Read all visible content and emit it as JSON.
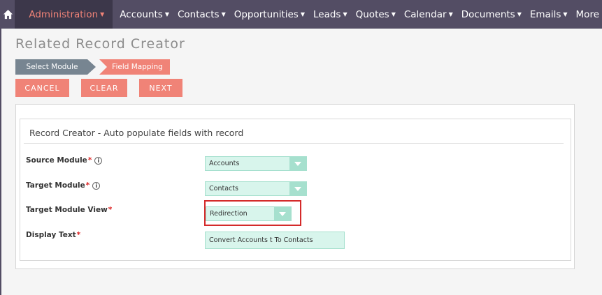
{
  "nav": {
    "items": [
      {
        "label": "Administration",
        "active": true
      },
      {
        "label": "Accounts"
      },
      {
        "label": "Contacts"
      },
      {
        "label": "Opportunities"
      },
      {
        "label": "Leads"
      },
      {
        "label": "Quotes"
      },
      {
        "label": "Calendar"
      },
      {
        "label": "Documents"
      },
      {
        "label": "Emails"
      },
      {
        "label": "More"
      }
    ]
  },
  "page": {
    "title": "Related Record Creator"
  },
  "steps": {
    "step1": "Select Module",
    "step2": "Field Mapping"
  },
  "buttons": {
    "cancel": "CANCEL",
    "clear": "CLEAR",
    "next": "NEXT"
  },
  "panel": {
    "title": "Record Creator - Auto populate fields with record",
    "fields": {
      "source_module": {
        "label": "Source Module",
        "value": "Accounts"
      },
      "target_module": {
        "label": "Target Module",
        "value": "Contacts"
      },
      "target_module_view": {
        "label": "Target Module View",
        "value": "Redirection"
      },
      "display_text": {
        "label": "Display Text",
        "value": "Convert Accounts t To Contacts"
      }
    }
  },
  "colors": {
    "nav_bg": "#534d64",
    "accent": "#f08377",
    "field_bg": "#d8f5ec",
    "field_arrow": "#a6e0ce",
    "highlight": "#d42a2a"
  },
  "icons": {
    "home": "home-icon",
    "info": "info-icon",
    "dropdown": "chevron-down-icon"
  }
}
